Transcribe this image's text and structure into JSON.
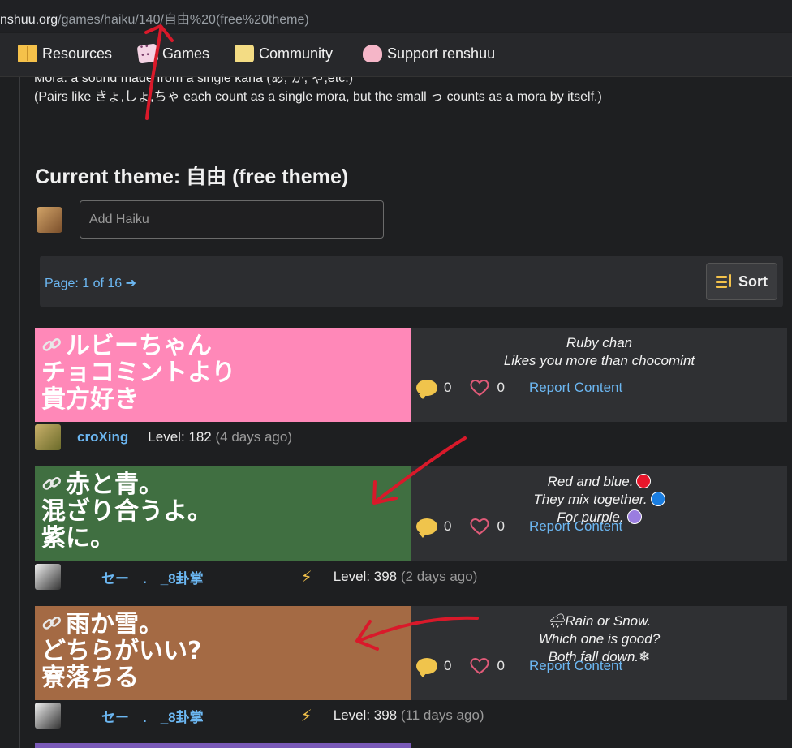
{
  "browser": {
    "url_host": "nshuu.org",
    "url_path": "/games/haiku/140/自由%20(free%20theme)"
  },
  "nav": {
    "items": [
      {
        "label": "Resources",
        "icon": "book-icon"
      },
      {
        "label": "Games",
        "icon": "dice-icon"
      },
      {
        "label": "Community",
        "icon": "chat-icon"
      },
      {
        "label": "Support renshuu",
        "icon": "heart-icon"
      }
    ]
  },
  "intro": {
    "line1": "Mora: a sound made from a single kana (あ, か, ゃ,etc.)",
    "line2": "(Pairs like きょ,しょ,ちゃ each count as a single mora, but the small っ counts as a mora by itself.)"
  },
  "theme_title": "Current theme: 自由 (free theme)",
  "add_haiku": {
    "placeholder": "Add Haiku"
  },
  "pager": {
    "label": "Page: 1 of 16",
    "sort_label": "Sort"
  },
  "posts": [
    {
      "color": "#ff88b8",
      "poem": [
        "ルビーちゃん",
        "チョコミントより",
        "貴方好き"
      ],
      "translation": [
        "Ruby chan",
        "Likes you more than chocomint"
      ],
      "comments": "0",
      "likes": "0",
      "report": "Report Content",
      "user": "croXing",
      "level": "Level: 182",
      "ago": "(4 days ago)"
    },
    {
      "color": "#406f41",
      "poem": [
        "赤と青。",
        "混ざり合うよ。",
        "紫に。"
      ],
      "translation": [
        "Red and blue.",
        "They mix together.",
        "For purple."
      ],
      "dots": [
        "#e8162b",
        "#1a7de0",
        "#9a7de0"
      ],
      "comments": "0",
      "likes": "0",
      "report": "Report Content",
      "user": "セー　.　_8卦掌",
      "level": "Level: 398",
      "ago": "(2 days ago)"
    },
    {
      "color": "#a46a44",
      "poem": [
        "雨か雪。",
        "どちらがいい?",
        "寮落ちる"
      ],
      "translation": [
        "🌧Rain or Snow.",
        "Which one is good?",
        "Both fall down.❄"
      ],
      "comments": "0",
      "likes": "0",
      "report": "Report Content",
      "user": "セー　.　_8卦掌",
      "level": "Level: 398",
      "ago": "(11 days ago)"
    }
  ],
  "colors": {
    "link": "#6cb7f2",
    "annotation_red": "#d9192a"
  }
}
